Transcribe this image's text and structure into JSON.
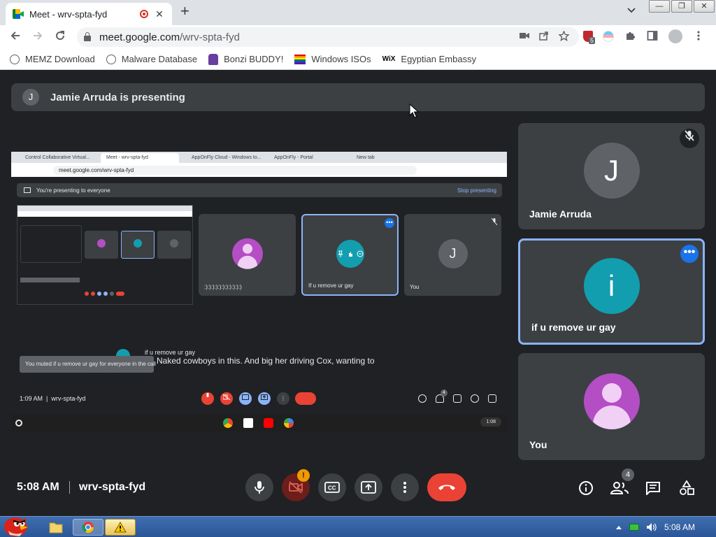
{
  "browser": {
    "tab_title": "Meet - wrv-spta-fyd",
    "tab_close": "✕",
    "new_tab": "+",
    "url_host": "meet.google.com",
    "url_path": "/wrv-spta-fyd",
    "extension_badge": "5",
    "window_buttons": [
      "—",
      "❐",
      "✕"
    ]
  },
  "bookmarks": [
    {
      "label": "MEMZ Download",
      "icon": "globe-icon"
    },
    {
      "label": "Malware Database",
      "icon": "globe-icon"
    },
    {
      "label": "Bonzi BUDDY!",
      "icon": "bonzi-icon"
    },
    {
      "label": "Windows ISOs",
      "icon": "rainbow-flag-icon"
    },
    {
      "label": "Egyptian Embassy",
      "icon": "wix-icon",
      "icon_text": "WiX"
    }
  ],
  "meet": {
    "presenter_initial": "J",
    "presenter_text": "Jamie Arruda is presenting",
    "time": "5:08 AM",
    "meeting_code": "wrv-spta-fyd",
    "camera_warning": "!",
    "people_count": "4"
  },
  "shared_screen": {
    "tabs": [
      "Control Collaborative Virtual...",
      "Meet - wrv-spta-fyd",
      "AppOnFly Cloud - Windows to...",
      "AppOnFly - Portal",
      "New tab"
    ],
    "url": "meet.google.com/wrv-spta-fyd",
    "presenting_text": "You're presenting to everyone",
    "stop_presenting": "Stop presenting",
    "tiles": [
      {
        "name": ":):):):):):):):):):):)",
        "type": "person"
      },
      {
        "name": "If u remove ur gay",
        "type": "teal",
        "highlighted": true
      },
      {
        "name": "You",
        "initial": "J",
        "type": "initial"
      }
    ],
    "caption_speaker": "if u remove ur gay",
    "caption_text": "Naked cowboys in this. And big her driving Cox, wanting to",
    "toast": "You muted if u remove ur gay for everyone in the call",
    "time": "1:09 AM",
    "meeting_code": "wrv-spta-fyd",
    "people_count": "4",
    "shelf_time": "1:08"
  },
  "participants": [
    {
      "name": "Jamie Arruda",
      "initial": "J",
      "avatar_color": "#5f6368",
      "muted": true
    },
    {
      "name": "if u remove ur gay",
      "initial": "i",
      "avatar_color": "#129eaf",
      "highlighted": true
    },
    {
      "name": "You",
      "avatar_type": "person"
    }
  ],
  "taskbar": {
    "time": "5:08 AM"
  }
}
